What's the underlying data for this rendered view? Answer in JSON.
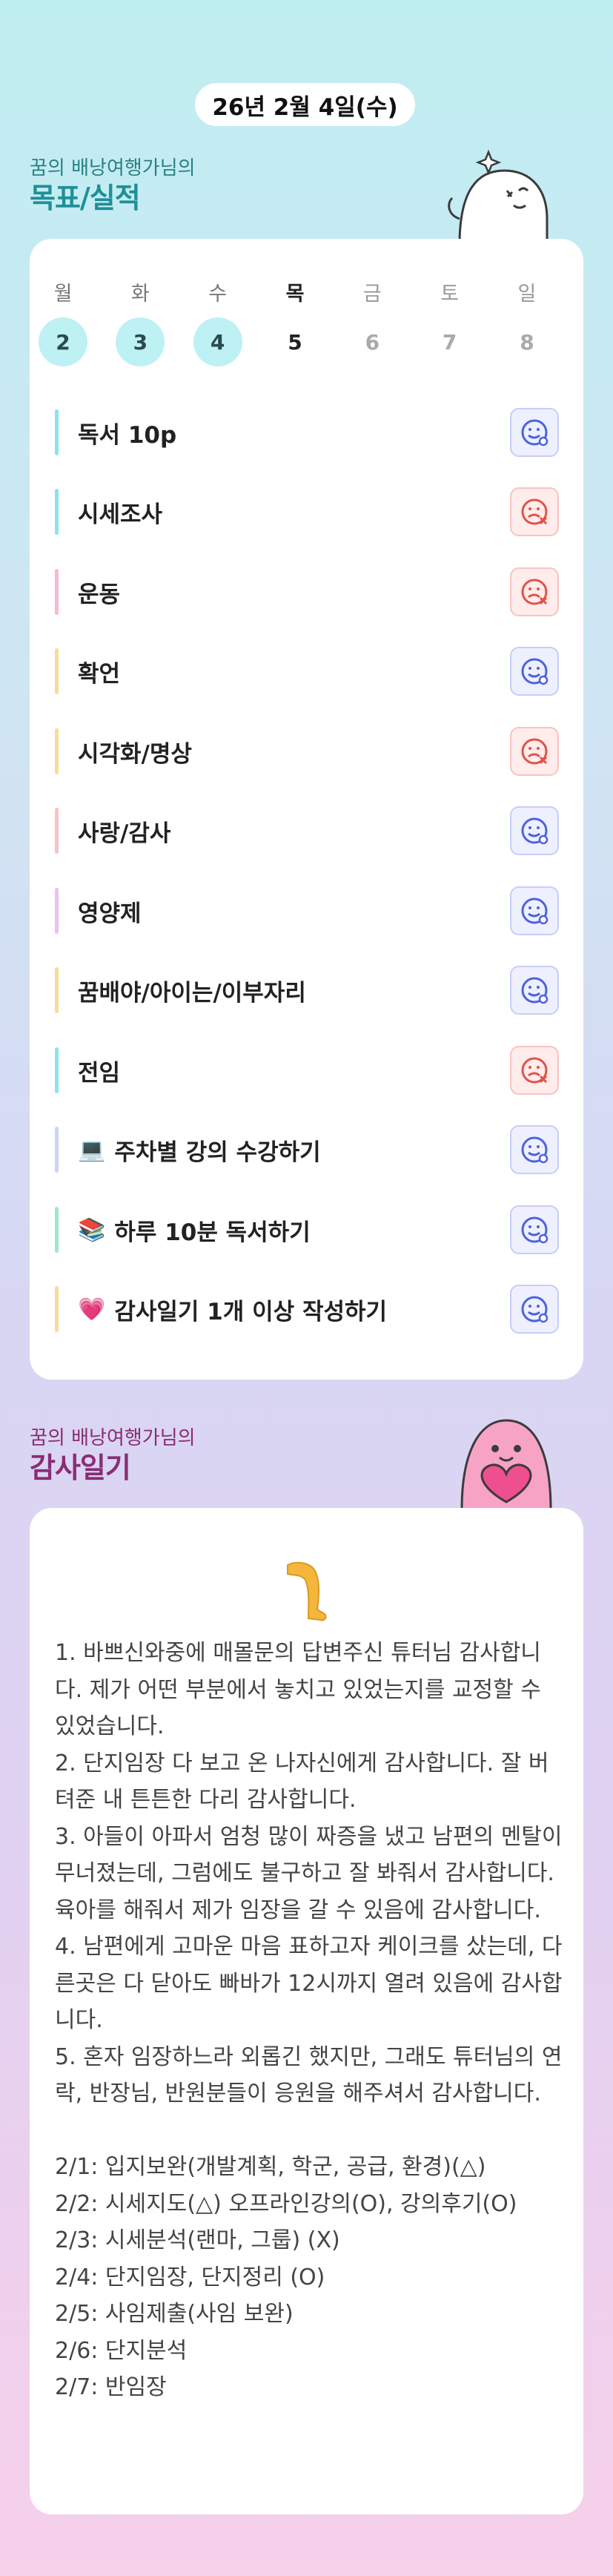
{
  "date": "26년 2월 4일(수)",
  "goals": {
    "subtitle": "꿈의 배낭여행가님의",
    "title": "목표/실적"
  },
  "week": [
    {
      "day": "월",
      "date": "2",
      "state": "done"
    },
    {
      "day": "화",
      "date": "3",
      "state": "done"
    },
    {
      "day": "수",
      "date": "4",
      "state": "done"
    },
    {
      "day": "목",
      "date": "5",
      "state": "today"
    },
    {
      "day": "금",
      "date": "6",
      "state": "future"
    },
    {
      "day": "토",
      "date": "7",
      "state": "future"
    },
    {
      "day": "일",
      "date": "8",
      "state": "future"
    }
  ],
  "tasks": [
    {
      "label": "독서 10p",
      "emoji": "",
      "status": "done",
      "accent": "#8ee3ea"
    },
    {
      "label": "시세조사",
      "emoji": "",
      "status": "missed",
      "accent": "#8ee3ea"
    },
    {
      "label": "운동",
      "emoji": "",
      "status": "missed",
      "accent": "#f6b9d8"
    },
    {
      "label": "확언",
      "emoji": "",
      "status": "done",
      "accent": "#f7dc9a"
    },
    {
      "label": "시각화/명상",
      "emoji": "",
      "status": "missed",
      "accent": "#f7dc9a"
    },
    {
      "label": "사랑/감사",
      "emoji": "",
      "status": "done",
      "accent": "#f9c3c3"
    },
    {
      "label": "영양제",
      "emoji": "",
      "status": "done",
      "accent": "#e7c3ee"
    },
    {
      "label": "꿈배야/아이는/이부자리",
      "emoji": "",
      "status": "done",
      "accent": "#f7dc9a"
    },
    {
      "label": "전임",
      "emoji": "",
      "status": "missed",
      "accent": "#8ee3ea"
    },
    {
      "label": "주차별 강의 수강하기",
      "emoji": "💻",
      "status": "done",
      "accent": "#c9d6f3"
    },
    {
      "label": "하루 10분 독서하기",
      "emoji": "📚",
      "status": "done",
      "accent": "#9ee6cf"
    },
    {
      "label": "감사일기 1개 이상 작성하기",
      "emoji": "💗",
      "status": "done",
      "accent": "#f7dc9a"
    }
  ],
  "journal": {
    "subtitle": "꿈의 배낭여행가님의",
    "title": "감사일기",
    "text": "1. 바쁘신와중에 매몰문의 답변주신 튜터님 감사합니다. 제가 어떤 부분에서 놓치고 있었는지를 교정할 수 있었습니다.\n2. 단지임장 다 보고 온 나자신에게 감사합니다. 잘 버텨준 내 튼튼한 다리 감사합니다.\n3. 아들이 아파서 엄청 많이 짜증을 냈고 남편의 멘탈이 무너졌는데, 그럼에도 불구하고 잘 봐줘서 감사합니다. 육아를 해줘서 제가 임장을 갈 수 있음에 감사합니다.\n4. 남편에게 고마운 마음 표하고자 케이크를 샀는데, 다른곳은 다 닫아도 빠바가 12시까지 열려 있음에 감사합니다.\n5. 혼자 임장하느라 외롭긴 했지만, 그래도 튜터님의 연락, 반장님, 반원분들이 응원을 해주셔서 감사합니다.\n\n2/1: 입지보완(개발계획, 학군, 공급, 환경)(△)\n2/2: 시세지도(△) 오프라인강의(O), 강의후기(O)\n2/3: 시세분석(랜마, 그룹) (X)\n2/4: 단지임장, 단지정리 (O)\n2/5: 사임제출(사임 보완)\n2/6: 단지분석\n2/7: 반임장"
  },
  "colors": {
    "teal_title": "#1f8f98",
    "purple_title": "#8a2c76",
    "done_icon": "#4a63e0",
    "missed_icon": "#e0524b"
  }
}
